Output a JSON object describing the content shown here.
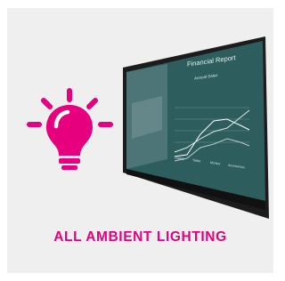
{
  "caption": "ALL AMBIENT LIGHTING",
  "icons": {
    "bulb": "lightbulb-icon"
  },
  "colors": {
    "accent": "#e6007e",
    "panel_bg": "#efefef",
    "screen_bg": "#2e5d5e",
    "bezel": "#1c1c1c"
  },
  "screen": {
    "title": "Financial Report",
    "subtitle": "Annual Sales",
    "legend": [
      "Laptop",
      "Tablet",
      "Monitor",
      "Accessories"
    ]
  }
}
